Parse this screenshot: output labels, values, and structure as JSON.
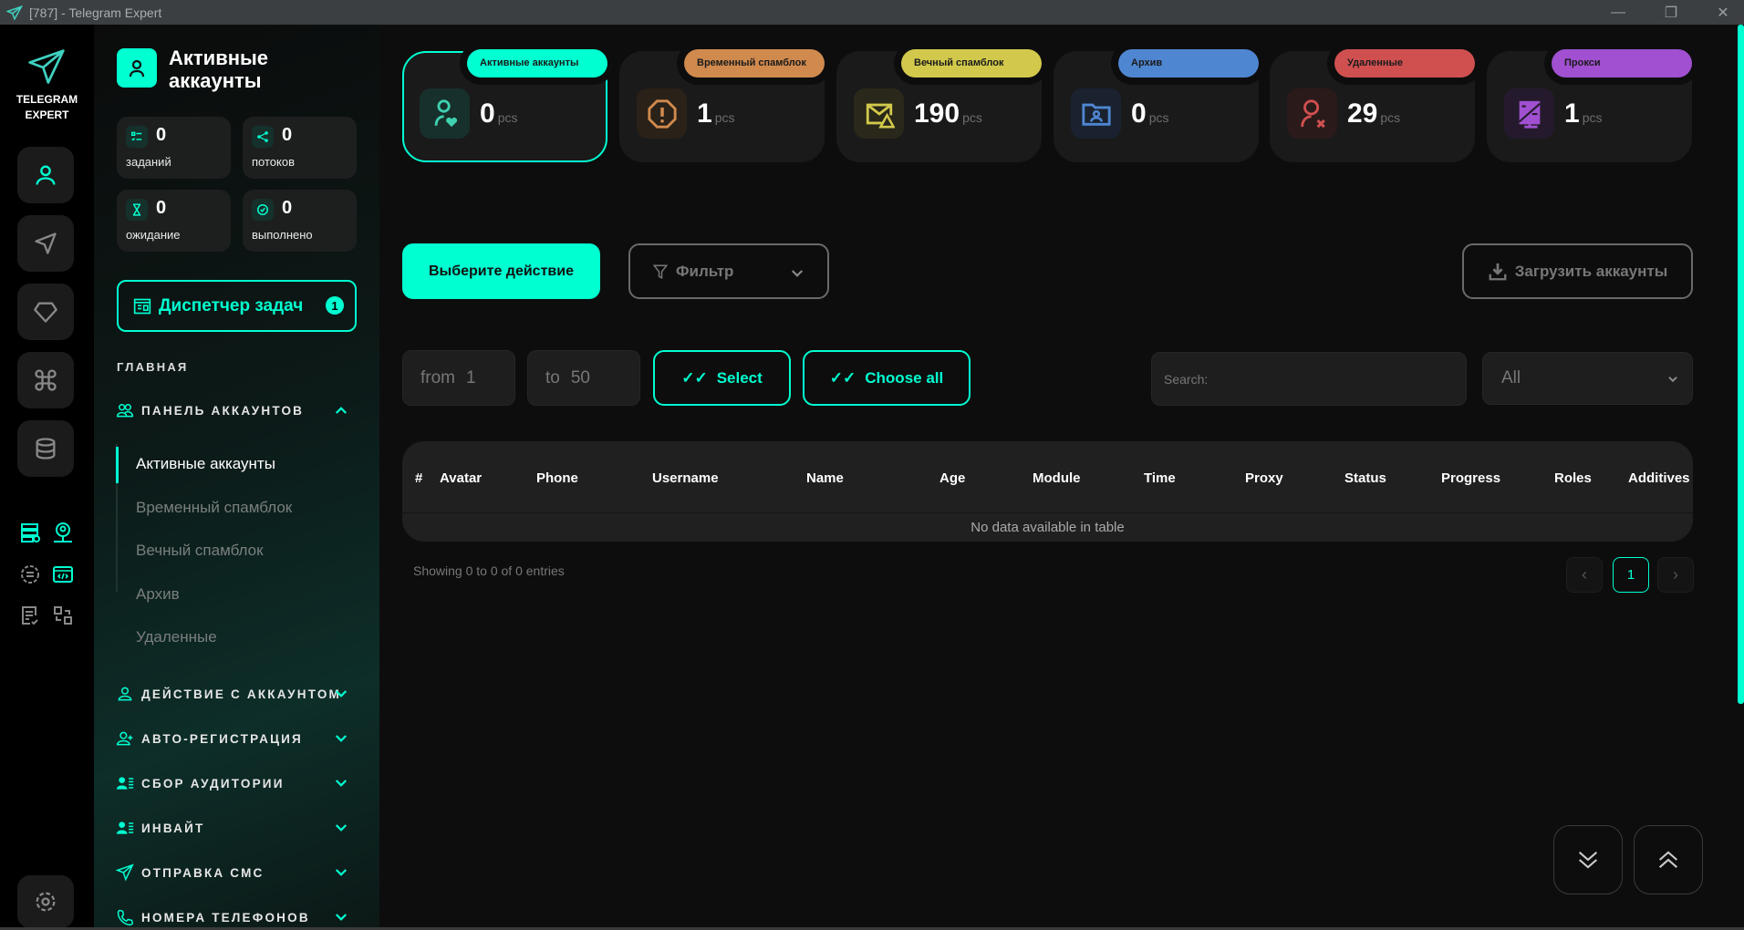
{
  "window": {
    "title": "[787] - Telegram Expert"
  },
  "logo": {
    "line1": "TELEGRAM",
    "line2": "EXPERT"
  },
  "sidebar": {
    "header_title": "Активные аккаунты",
    "stats": [
      {
        "value": "0",
        "label": "заданий",
        "icon": "checklist-icon"
      },
      {
        "value": "0",
        "label": "потоков",
        "icon": "share-nodes-icon"
      },
      {
        "value": "0",
        "label": "ожидание",
        "icon": "hourglass-icon"
      },
      {
        "value": "0",
        "label": "выполнено",
        "icon": "check-circle-icon"
      }
    ],
    "task_manager": {
      "label": "Диспетчер задач",
      "badge": "1"
    },
    "main_heading": "ГЛАВНАЯ",
    "accounts_panel": {
      "label": "ПАНЕЛЬ АККАУНТОВ",
      "items": [
        "Активные аккаунты",
        "Временный спамблок",
        "Вечный спамблок",
        "Архив",
        "Удаленные"
      ]
    },
    "sections": [
      "ДЕЙСТВИЕ С АККАУНТОМ",
      "АВТО-РЕГИСТРАЦИЯ",
      "СБОР АУДИТОРИИ",
      "ИНВАЙТ",
      "ОТПРАВКА СМС",
      "НОМЕРА ТЕЛЕФОНОВ"
    ]
  },
  "cards": [
    {
      "label": "Активные аккаунты",
      "value": "0",
      "unit": "pcs",
      "color": "#00ffd1",
      "icon": "user-heart-icon"
    },
    {
      "label": "Временный спамблок",
      "value": "1",
      "unit": "pcs",
      "color": "#d08a4e",
      "icon": "alert-octagon-icon"
    },
    {
      "label": "Вечный спамблок",
      "value": "190",
      "unit": "pcs",
      "color": "#d2c94c",
      "icon": "mail-warning-icon"
    },
    {
      "label": "Архив",
      "value": "0",
      "unit": "pcs",
      "color": "#4f86d1",
      "icon": "folder-user-icon"
    },
    {
      "label": "Удаленные",
      "value": "29",
      "unit": "pcs",
      "color": "#d05050",
      "icon": "user-x-icon"
    },
    {
      "label": "Прокси",
      "value": "1",
      "unit": "pcs",
      "color": "#a050d0",
      "icon": "proxy-server-icon"
    }
  ],
  "toolbar": {
    "action": "Выберите действие",
    "filter": "Фильтр",
    "upload": "Загрузить аккаунты"
  },
  "range": {
    "from_label": "from",
    "from_value": "1",
    "to_label": "to",
    "to_value": "50",
    "select": "Select",
    "choose_all": "Choose all"
  },
  "search": {
    "placeholder": "Search:"
  },
  "status_select": {
    "value": "All"
  },
  "table": {
    "columns": [
      "#",
      "Avatar",
      "Phone",
      "Username",
      "Name",
      "Age",
      "Module",
      "Time",
      "Proxy",
      "Status",
      "Progress",
      "Roles",
      "Additives"
    ],
    "empty": "No data available in table",
    "info": "Showing 0 to 0 of 0 entries"
  },
  "pagination": {
    "prev": "‹",
    "current": "1",
    "next": "›"
  },
  "accent": "#00ffd1"
}
